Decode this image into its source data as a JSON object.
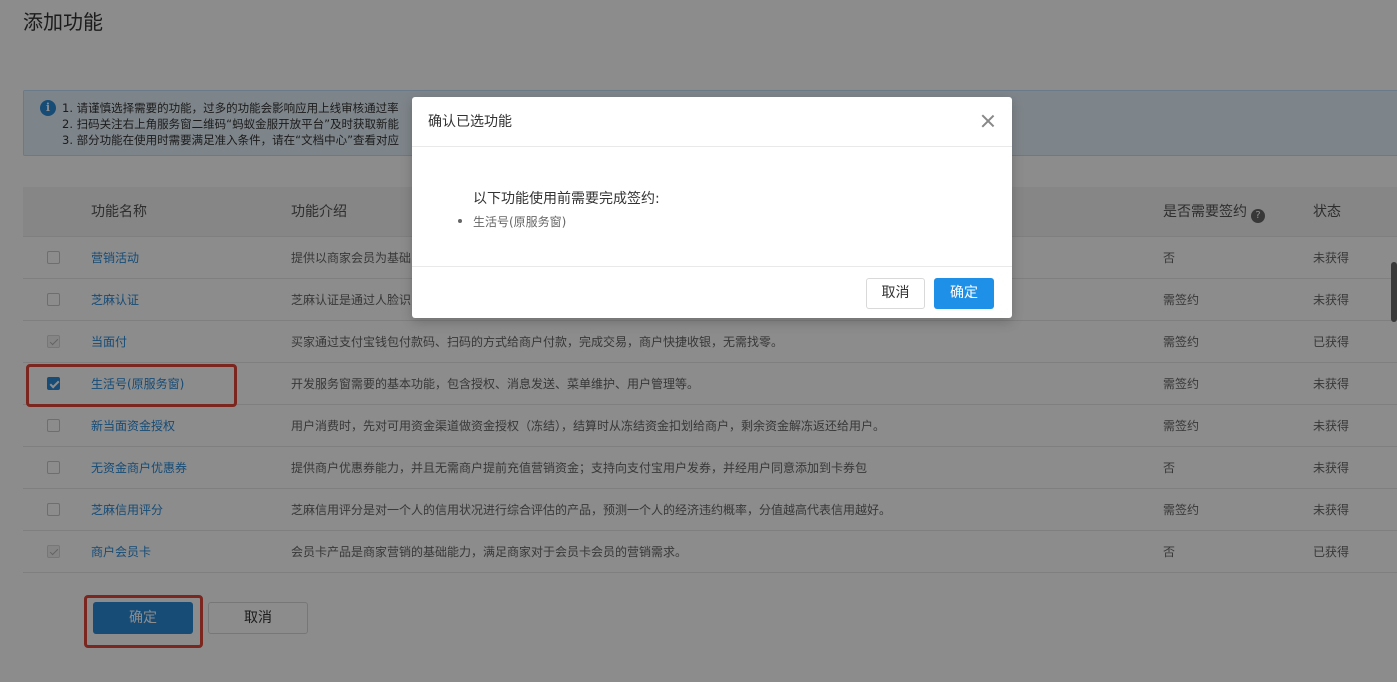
{
  "page": {
    "title": "添加功能"
  },
  "notice": {
    "icon": "info-icon",
    "lines": [
      "1. 请谨慎选择需要的功能，过多的功能会影响应用上线审核通过率",
      "2. 扫码关注右上角服务窗二维码“蚂蚁金服开放平台”及时获取新能",
      "3. 部分功能在使用时需要满足准入条件，请在“文档中心”查看对应"
    ]
  },
  "table": {
    "headers": {
      "name": "功能名称",
      "desc": "功能介绍",
      "sign": "是否需要签约",
      "status": "状态"
    },
    "rows": [
      {
        "name": "营销活动",
        "desc": "提供以商家会员为基础",
        "sign": "否",
        "status": "未获得",
        "check": "unchecked"
      },
      {
        "name": "芝麻认证",
        "desc": "芝麻认证是通过人脸识",
        "sign": "需签约",
        "status": "未获得",
        "check": "unchecked"
      },
      {
        "name": "当面付",
        "desc": "买家通过支付宝钱包付款码、扫码的方式给商户付款，完成交易，商户快捷收银，无需找零。",
        "sign": "需签约",
        "status": "已获得",
        "check": "disabled"
      },
      {
        "name": "生活号(原服务窗)",
        "desc": "开发服务窗需要的基本功能，包含授权、消息发送、菜单维护、用户管理等。",
        "sign": "需签约",
        "status": "未获得",
        "check": "checked"
      },
      {
        "name": "新当面资金授权",
        "desc": "用户消费时，先对可用资金渠道做资金授权（冻结），结算时从冻结资金扣划给商户，剩余资金解冻返还给用户。",
        "sign": "需签约",
        "status": "未获得",
        "check": "unchecked"
      },
      {
        "name": "无资金商户优惠券",
        "desc": "提供商户优惠券能力，并且无需商户提前充值营销资金；支持向支付宝用户发券，并经用户同意添加到卡券包",
        "sign": "否",
        "status": "未获得",
        "check": "unchecked"
      },
      {
        "name": "芝麻信用评分",
        "desc": "芝麻信用评分是对一个人的信用状况进行综合评估的产品，预测一个人的经济违约概率，分值越高代表信用越好。",
        "sign": "需签约",
        "status": "未获得",
        "check": "unchecked"
      },
      {
        "name": "商户会员卡",
        "desc": "会员卡产品是商家营销的基础能力，满足商家对于会员卡会员的营销需求。",
        "sign": "否",
        "status": "已获得",
        "check": "disabled"
      }
    ]
  },
  "actions": {
    "confirm_label": "确定",
    "cancel_label": "取消"
  },
  "modal": {
    "title": "确认已选功能",
    "heading": "以下功能使用前需要完成签约:",
    "items": [
      "生活号(原服务窗)"
    ],
    "cancel_label": "取消",
    "ok_label": "确定"
  },
  "colors": {
    "primary": "#2a8ad8",
    "highlight": "#e0453a",
    "notice_bg": "#e6f3fc"
  }
}
